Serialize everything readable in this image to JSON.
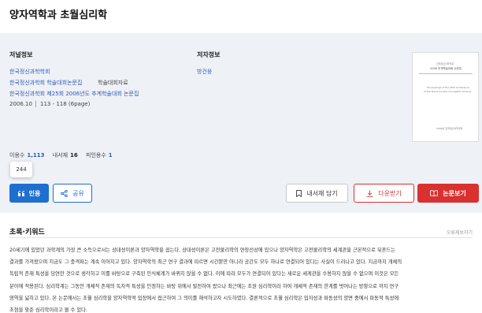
{
  "title": "양자역학과 초월심리학",
  "publication": {
    "heading": "저널정보",
    "society": "한국정신과학학회",
    "conference": "한국정신과학회 학술대회논문집",
    "type": "학술대회자료",
    "proceedings": "한국정신과학회 제25회 2006년도 추계학술대회 논문집",
    "date": "2006.10",
    "pages": "113 - 118 (6page)"
  },
  "author": {
    "heading": "저자정보",
    "name": "방건웅"
  },
  "cover": {
    "small_top": "한국정신과학학회",
    "main": "2006 추계학술대회 논문집",
    "sub1": "Proceedings of the 25th Conference",
    "sub2": "of the Korea Society of Jungshin Science",
    "bottom": "2006년 한국정신과학학회"
  },
  "stats": {
    "usage_label": "이용수",
    "usage_value": "1,113",
    "saved_label": "내서재",
    "saved_value": "16",
    "cited_label": "피인용수",
    "cited_value": "1"
  },
  "tooltip": "244",
  "buttons": {
    "cite": "인용",
    "share": "공유",
    "save": "내서재 담기",
    "download": "다운받기",
    "view": "논문보기"
  },
  "section": {
    "heading": "초록·키워드",
    "more": "오류제보하기"
  },
  "abstract": [
    "20세기에 있었던 과학계의 가장 큰 소득으로서는 상대성이론과 양자역학을 꼽는다. 상대성이론은 고전물리학의 연장선상에 있으나 양자역학은 고전물리학의 세계관을 근본적으로 뒤흔드는",
    "결과를 가져왔으며 지금도 그 충격파는 계속 이어지고 있다. 양자역학의 최근 연구 결과에 따르면 시간뿐만 아니라 공간도 모두 하나로 연결되어 있다는 사실이 드러나고 있다. 지금까지 개체의",
    "독립적 존재 특성을 당연한 것으로 생각하고 이를 바탕으로 구축된 인식체계가 바뀌지 않을 수 없다. 이에 따라 모두가 연결되어 있다는 새로운 세계관을 수용하지 않을 수 없으며 이것은 모든",
    "분야에 적용된다. 심리학계는 그동안 개체적 존재의 독자적 특성을 인정하는 바탕 위에서 발전하여 왔으나 최근에는 초원 심리학이라 하여 개체적 존재의 한계를 벗어나는 방향으로 까지 연구",
    "영역을 넓히고 있다. 본 논문에서는 초월 심리학을 양자역학적 입장에서 접근하여 그 의미를 해석하고자 시도하였다. 결론적으로 초월 심리학은 입자성과 파동성의 양면 중에서 파동적 특성에",
    "초점을 맞춘 심리학이라고 볼 수 있다."
  ]
}
